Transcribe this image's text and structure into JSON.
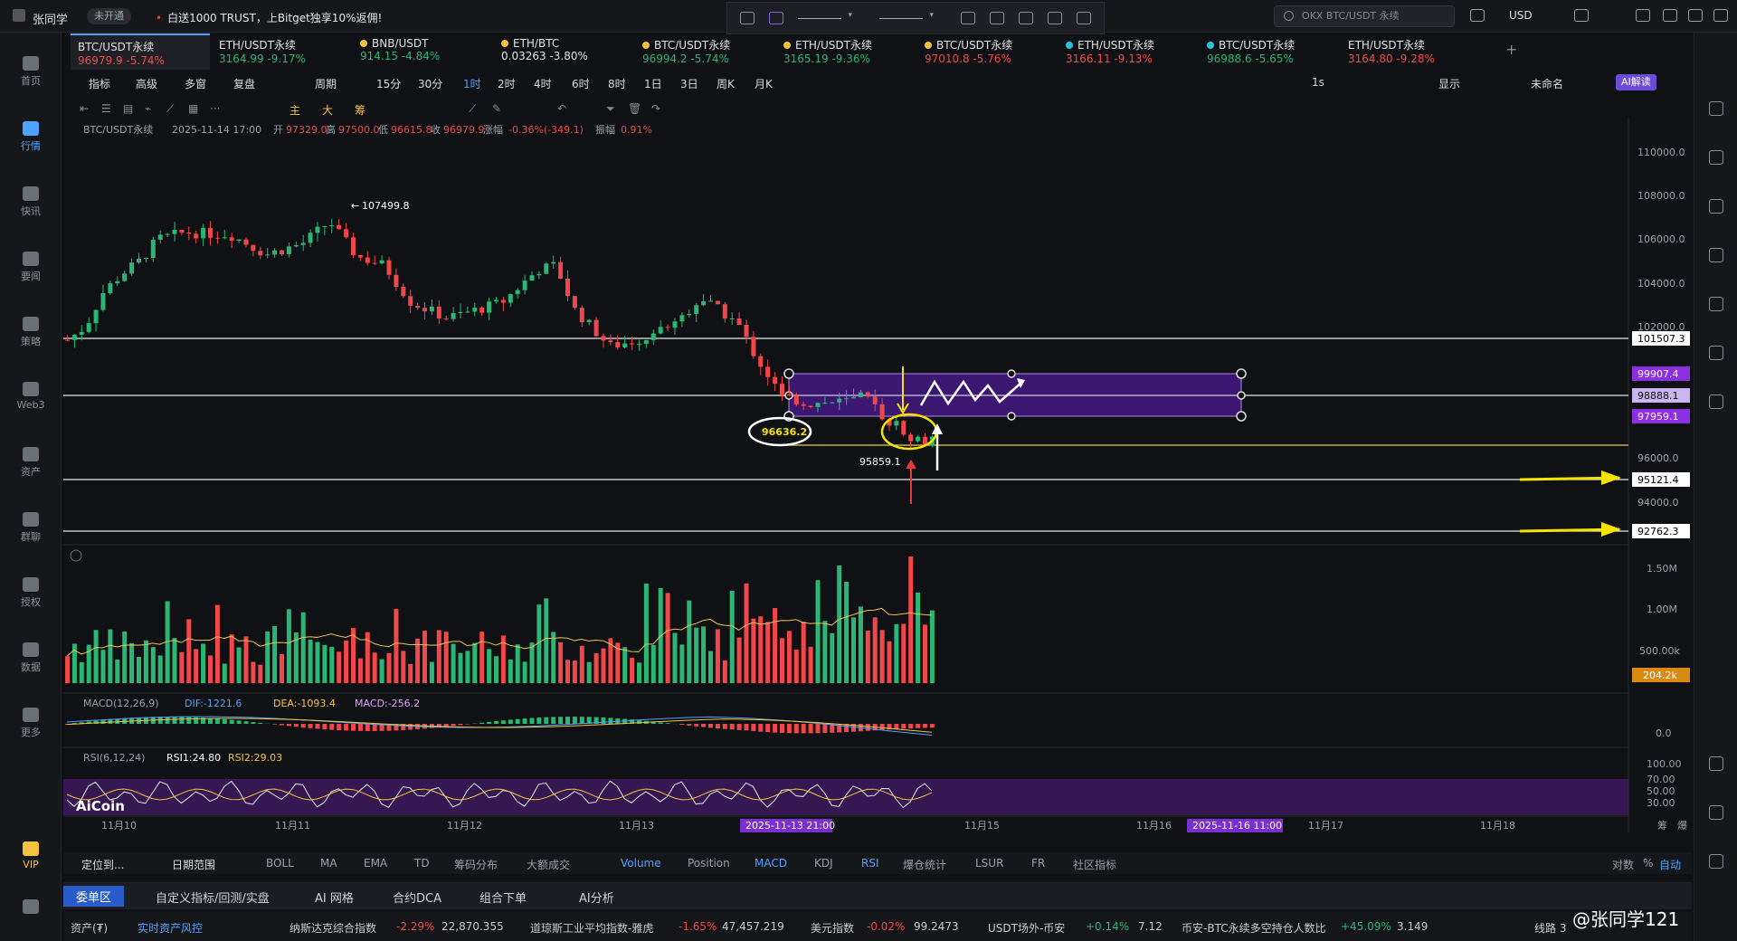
{
  "top": {
    "user": "张同学",
    "badge": "未开通",
    "promo": "白送1000 TRUST，上Bitget独享10%返佣!",
    "search_placeholder": "OKX BTC/USDT 永续",
    "currency": "USD"
  },
  "nav": [
    {
      "label": "首页"
    },
    {
      "label": "行情"
    },
    {
      "label": "快讯"
    },
    {
      "label": "要闻"
    },
    {
      "label": "策略"
    },
    {
      "label": "Web3"
    },
    {
      "label": "资产"
    },
    {
      "label": "群聊"
    },
    {
      "label": "授权"
    },
    {
      "label": "数据"
    },
    {
      "label": "更多"
    },
    {
      "label": "VIP"
    }
  ],
  "tabs": [
    {
      "name": "BTC/USDT永续",
      "price": "96979.9",
      "change": "-5.74%"
    },
    {
      "name": "ETH/USDT永续",
      "price": "3164.99",
      "change": "-9.17%"
    },
    {
      "name": "BNB/USDT",
      "price": "914.15",
      "change": "-4.84%"
    },
    {
      "name": "ETH/BTC",
      "price": "0.03263",
      "change": "-3.80%"
    },
    {
      "name": "BTC/USDT永续",
      "price": "96994.2",
      "change": "-5.74%"
    },
    {
      "name": "ETH/USDT永续",
      "price": "3165.19",
      "change": "-9.36%"
    },
    {
      "name": "BTC/USDT永续",
      "price": "97010.8",
      "change": "-5.76%"
    },
    {
      "name": "ETH/USDT永续",
      "price": "3166.11",
      "change": "-9.13%"
    },
    {
      "name": "BTC/USDT永续",
      "price": "96988.6",
      "change": "-5.65%"
    },
    {
      "name": "ETH/USDT永续",
      "price": "3164.80",
      "change": "-9.28%"
    }
  ],
  "add_tab": "+",
  "toolbar": {
    "items": [
      "指标",
      "高级",
      "多窗",
      "复盘"
    ],
    "period": "周期",
    "intervals": [
      "15分",
      "30分",
      "1时",
      "2时",
      "4时",
      "6时",
      "8时",
      "1日",
      "3日",
      "周K",
      "月K"
    ],
    "selected": "1时",
    "right": [
      "1s",
      "显示",
      "未命名"
    ],
    "ai": "AI解读"
  },
  "draw_tools": [
    "主",
    "大",
    "筹"
  ],
  "ohlc": {
    "symbol": "BTC/USDT永续",
    "time": "2025-11-14 17:00",
    "open_label": "开",
    "open": "97329.0",
    "high_label": "高",
    "high": "97500.0",
    "low_label": "低",
    "low": "96615.8",
    "close_label": "收",
    "close": "96979.9",
    "chg_label": "涨幅",
    "chg": "-0.36%(-349.1)",
    "amp_label": "振幅",
    "amp": "0.91%"
  },
  "price_axis": [
    "110000.0",
    "108000.0",
    "106000.0",
    "104000.0",
    "102000.0",
    "96000.0",
    "94000.0"
  ],
  "price_tags": [
    {
      "text": "101507.3",
      "bg": "#ffffff",
      "fg": "#000"
    },
    {
      "text": "99907.4",
      "bg": "#8b2fe0",
      "fg": "#fff"
    },
    {
      "text": "98888.1",
      "bg": "#c9b6f0",
      "fg": "#000"
    },
    {
      "text": "97959.1",
      "bg": "#8b2fe0",
      "fg": "#fff"
    },
    {
      "text": "95121.4",
      "bg": "#ffffff",
      "fg": "#000"
    },
    {
      "text": "92762.3",
      "bg": "#ffffff",
      "fg": "#000"
    }
  ],
  "annotations": {
    "high": "107499.8",
    "low": "95859.1",
    "circle": "96636.2"
  },
  "volume_axis": [
    "1.50M",
    "1.00M",
    "500.00k"
  ],
  "volume_tag": "204.2k",
  "macd": {
    "label": "MACD(12,26,9)",
    "dif": "DIF:-1221.6",
    "dea": "DEA:-1093.4",
    "macd": "MACD:-256.2",
    "zero": "0.0"
  },
  "rsi": {
    "label": "RSI(6,12,24)",
    "rsi1": "RSI1:24.80",
    "rsi2": "RSI2:29.03",
    "levels": [
      "100.00",
      "70.00",
      "50.00",
      "30.00"
    ]
  },
  "brand": "AiCoin",
  "time_axis": [
    "11月10",
    "11月11",
    "11月12",
    "11月13",
    "11月15",
    "11月16",
    "11月17",
    "11月18"
  ],
  "time_highlight": [
    "2025-11-13 21:00",
    "2025-11-16 11:00"
  ],
  "corner": [
    "筹",
    "爆"
  ],
  "bottom_tabs": {
    "left": [
      "定位到...",
      "日期范围"
    ],
    "items": [
      "BOLL",
      "MA",
      "EMA",
      "TD",
      "筹码分布",
      "大额成交",
      "Volume",
      "Position",
      "MACD",
      "KDJ",
      "RSI",
      "爆仓统计",
      "LSUR",
      "FR",
      "社区指标"
    ],
    "active": [
      "Volume",
      "MACD",
      "RSI"
    ],
    "right": [
      "对数",
      "%",
      "自动"
    ]
  },
  "panel_tabs": [
    "委单区",
    "自定义指标/回测/实盘",
    "AI 网格",
    "合约DCA",
    "组合下单",
    "AI分析"
  ],
  "status": [
    {
      "name": "资产(₮)",
      "chg": "",
      "val": ""
    },
    {
      "name": "实时资产风控",
      "chg": "",
      "val": ""
    },
    {
      "name": "纳斯达克综合指数",
      "chg": "-2.29%",
      "val": "22,870.355"
    },
    {
      "name": "道琼斯工业平均指数-雅虎",
      "chg": "-1.65%",
      "val": "47,457.219"
    },
    {
      "name": "美元指数",
      "chg": "-0.02%",
      "val": "99.2473"
    },
    {
      "name": "USDT场外-币安",
      "chg": "+0.14%",
      "val": "7.12"
    },
    {
      "name": "币安-BTC永续多空持仓人数比",
      "chg": "+45.09%",
      "val": "3.149"
    }
  ],
  "line_label": "线路 3",
  "watermark": "@张同学121",
  "colors": {
    "up": "#2bb673",
    "down": "#f04848",
    "accent": "#4da3ff",
    "purple": "#6a25c9",
    "yellow": "#f5e400"
  }
}
